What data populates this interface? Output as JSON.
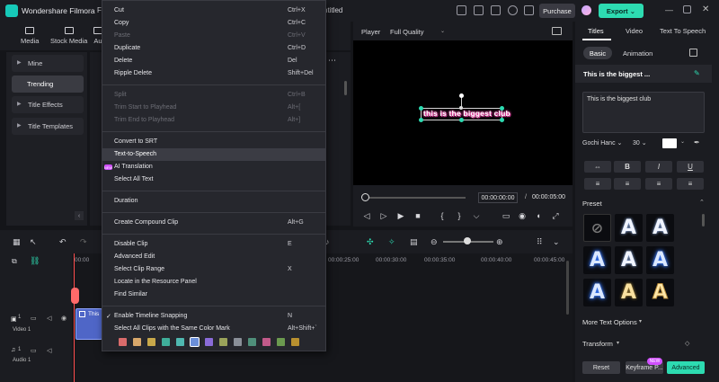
{
  "app": {
    "title": "Wondershare Filmora",
    "menu_fragment": "Fi",
    "project_fragment": "ntitled"
  },
  "header": {
    "purchase_label": "Purchase",
    "export_label": "Export"
  },
  "media_toolbar": {
    "tabs": [
      "Media",
      "Stock Media",
      "Au"
    ]
  },
  "left_nav": {
    "items": [
      "Mine",
      "Trending",
      "Title Effects",
      "Title Templates"
    ]
  },
  "context_menu": {
    "items": [
      {
        "label": "Cut",
        "shortcut": "Ctrl+X",
        "enabled": true
      },
      {
        "label": "Copy",
        "shortcut": "Ctrl+C",
        "enabled": true
      },
      {
        "label": "Paste",
        "shortcut": "Ctrl+V",
        "enabled": false
      },
      {
        "label": "Duplicate",
        "shortcut": "Ctrl+D",
        "enabled": true
      },
      {
        "label": "Delete",
        "shortcut": "Del",
        "enabled": true
      },
      {
        "label": "Ripple Delete",
        "shortcut": "Shift+Del",
        "enabled": true
      },
      {
        "label": "Split",
        "shortcut": "Ctrl+B",
        "enabled": false
      },
      {
        "label": "Trim Start to Playhead",
        "shortcut": "Alt+[",
        "enabled": false
      },
      {
        "label": "Trim End to Playhead",
        "shortcut": "Alt+]",
        "enabled": false
      },
      {
        "label": "Convert to SRT",
        "shortcut": "",
        "enabled": true
      },
      {
        "label": "Text-to-Speech",
        "shortcut": "",
        "enabled": true
      },
      {
        "label": "AI Translation",
        "shortcut": "",
        "enabled": true
      },
      {
        "label": "Select All Text",
        "shortcut": "",
        "enabled": true
      },
      {
        "label": "Duration",
        "shortcut": "",
        "enabled": true
      },
      {
        "label": "Create Compound Clip",
        "shortcut": "Alt+G",
        "enabled": true
      },
      {
        "label": "Disable Clip",
        "shortcut": "E",
        "enabled": true
      },
      {
        "label": "Advanced Edit",
        "shortcut": "",
        "enabled": true
      },
      {
        "label": "Select Clip Range",
        "shortcut": "X",
        "enabled": true
      },
      {
        "label": "Locate in the Resource Panel",
        "shortcut": "",
        "enabled": true
      },
      {
        "label": "Find Similar",
        "shortcut": "",
        "enabled": true
      },
      {
        "label": "Enable Timeline Snapping",
        "shortcut": "N",
        "enabled": true
      },
      {
        "label": "Select All Clips with the Same Color Mark",
        "shortcut": "Alt+Shift+`",
        "enabled": true
      }
    ],
    "ai_badge": "NEW",
    "color_marks": [
      "#d96b6b",
      "#d9a86b",
      "#c8a84a",
      "#3fae9a",
      "#4fb8b0",
      "#6b8fd9",
      "#8a6bd9",
      "#9aa35a",
      "#8a8f98",
      "#4f8f7a",
      "#c25a8a",
      "#6b9a4f",
      "#b8902f"
    ]
  },
  "player": {
    "label": "Player",
    "quality": "Full Quality",
    "title_overlay": "this is the biggest club",
    "time_current": "00:00:00:00",
    "time_separator": "/",
    "time_total": "00:00:05:00"
  },
  "right_panel": {
    "tabs": [
      "Titles",
      "Video",
      "Text To Speech"
    ],
    "subtabs": [
      "Basic",
      "Animation"
    ],
    "title_row_label": "This is the biggest ...",
    "text_value": "This is the biggest club",
    "font": "Gochi Hanc",
    "font_size": "30",
    "format_buttons": [
      "B",
      "I",
      "U"
    ],
    "preset_label": "Preset",
    "more_text_options": "More Text Options",
    "transform_label": "Transform",
    "reset_label": "Reset",
    "keyframe_label": "Keyframe P...",
    "new_badge": "NEW",
    "advanced_label": "Advanced",
    "preset_letter": "A"
  },
  "timeline": {
    "ruler": [
      "00:00",
      "00:00:25:00",
      "00:00:30:00",
      "00:00:35:00",
      "00:00:40:00",
      "00:00:45:00"
    ],
    "tracks": [
      {
        "num": "1",
        "label": "Video 1"
      },
      {
        "num": "1",
        "label": "Audio 1"
      }
    ],
    "clip_label": "This"
  }
}
